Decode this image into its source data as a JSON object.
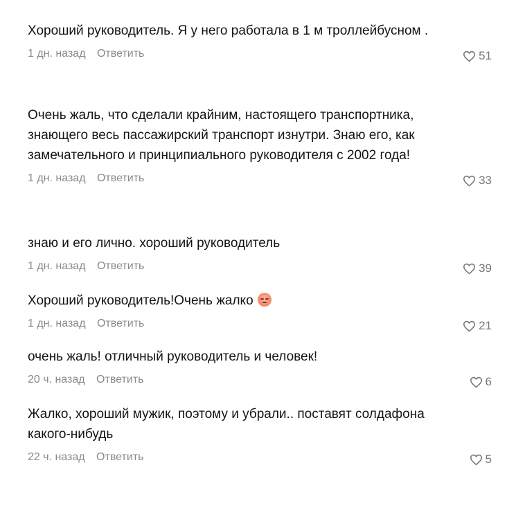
{
  "comments": [
    {
      "text": "Хороший руководитель. Я у него работала в 1 м троллейбусном .",
      "time": "1 дн. назад",
      "reply_label": "Ответить",
      "likes": "51"
    },
    {
      "text": "Очень жаль, что сделали крайним, настоящего транспортника, знающего весь пассажирский транспорт изнутри. Знаю его, как замечательного и принципиального руководителя с 2002 года!",
      "time": "1 дн. назад",
      "reply_label": "Ответить",
      "likes": "33"
    },
    {
      "text": "знаю и его лично. хороший руководитель",
      "time": "1 дн. назад",
      "reply_label": "Ответить",
      "likes": "39"
    },
    {
      "text": "Хороший руководитель!Очень жалко",
      "emoji": "pensive-face-emoji",
      "time": "1 дн. назад",
      "reply_label": "Ответить",
      "likes": "21"
    },
    {
      "text": "очень жаль! отличный руководитель и человек!",
      "time": "20 ч. назад",
      "reply_label": "Ответить",
      "likes": "6"
    },
    {
      "text": "Жалко, хороший мужик, поэтому и убрали.. поставят солдафона какого-нибудь",
      "time": "22 ч. назад",
      "reply_label": "Ответить",
      "likes": "5"
    }
  ],
  "icons": {
    "like": "heart-icon"
  },
  "colors": {
    "text": "#141414",
    "meta": "#8a8a8a"
  }
}
